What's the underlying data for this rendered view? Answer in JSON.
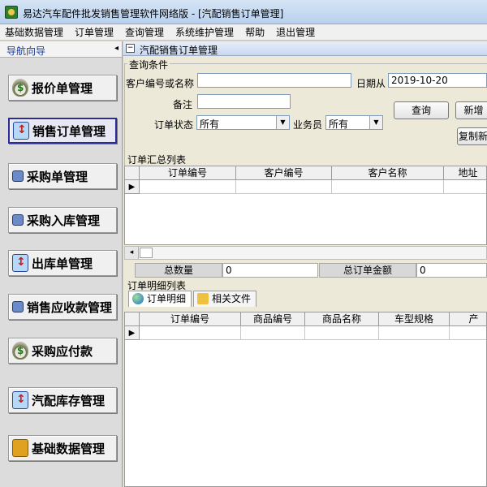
{
  "window": {
    "title": "易达汽车配件批发销售管理软件网络版 - [汽配销售订单管理]"
  },
  "menu": [
    "基础数据管理",
    "订单管理",
    "查询管理",
    "系统维护管理",
    "帮助",
    "退出管理"
  ],
  "sidebar": {
    "header": "导航向导",
    "collapse_glyph": "◂",
    "items": [
      {
        "label": "报价单管理",
        "icon": "money-bag-icon",
        "active": false
      },
      {
        "label": "销售订单管理",
        "icon": "order-icon",
        "active": true
      },
      {
        "label": "采购单管理",
        "icon": "purchase-icon",
        "active": false
      },
      {
        "label": "采购入库管理",
        "icon": "inbound-icon",
        "active": false
      },
      {
        "label": "出库单管理",
        "icon": "outbound-icon",
        "active": false
      },
      {
        "label": "销售应收款管理",
        "icon": "receivable-icon",
        "active": false
      },
      {
        "label": "采购应付款",
        "icon": "money-bag-icon",
        "active": false
      },
      {
        "label": "汽配库存管理",
        "icon": "stock-icon",
        "active": false
      },
      {
        "label": "基础数据管理",
        "icon": "database-icon",
        "active": false
      }
    ]
  },
  "pane": {
    "title": "汽配销售订单管理",
    "query": {
      "legend": "查询条件",
      "customer_label": "客户编号或名称",
      "customer_value": "",
      "date_from_label": "日期从",
      "date_from_value": "2019-10-20",
      "note_label": "备注",
      "note_value": "",
      "status_label": "订单状态",
      "status_value": "所有",
      "salesman_label": "业务员",
      "salesman_value": "所有",
      "search_button": "查询",
      "new_button": "新增",
      "copy_button": "复制新"
    },
    "summary": {
      "legend": "订单汇总列表",
      "columns": [
        "订单编号",
        "客户编号",
        "客户名称",
        "地址"
      ],
      "row_indicator": "▶",
      "scroll_left_glyph": "◂",
      "total_qty_label": "总数量",
      "total_qty_value": "0",
      "total_amount_label": "总订单金额",
      "total_amount_value": "0"
    },
    "detail": {
      "legend": "订单明细列表",
      "tabs": [
        "订单明细",
        "相关文件"
      ],
      "columns": [
        "订单编号",
        "商品编号",
        "商品名称",
        "车型规格",
        "产"
      ],
      "row_indicator": "▶"
    }
  }
}
